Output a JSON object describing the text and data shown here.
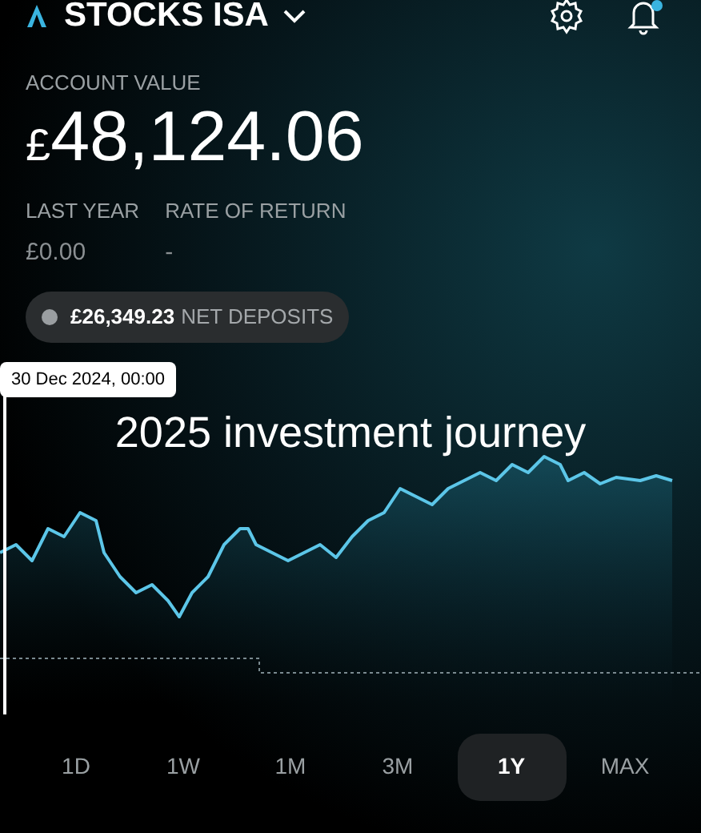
{
  "header": {
    "title": "STOCKS ISA",
    "notification_dot": true
  },
  "account": {
    "label": "ACCOUNT VALUE",
    "currency": "£",
    "value": "48,124.06"
  },
  "stats": [
    {
      "label": "LAST YEAR",
      "value": "£0.00"
    },
    {
      "label": "RATE OF RETURN",
      "value": "-"
    }
  ],
  "net_deposits": {
    "amount": "£26,349.23",
    "label": "NET DEPOSITS"
  },
  "chart": {
    "tooltip": "30 Dec 2024, 00:00",
    "caption": "2025 investment journey"
  },
  "ranges": [
    {
      "label": "1D",
      "selected": false
    },
    {
      "label": "1W",
      "selected": false
    },
    {
      "label": "1M",
      "selected": false
    },
    {
      "label": "3M",
      "selected": false
    },
    {
      "label": "1Y",
      "selected": true
    },
    {
      "label": "MAX",
      "selected": false
    }
  ]
}
